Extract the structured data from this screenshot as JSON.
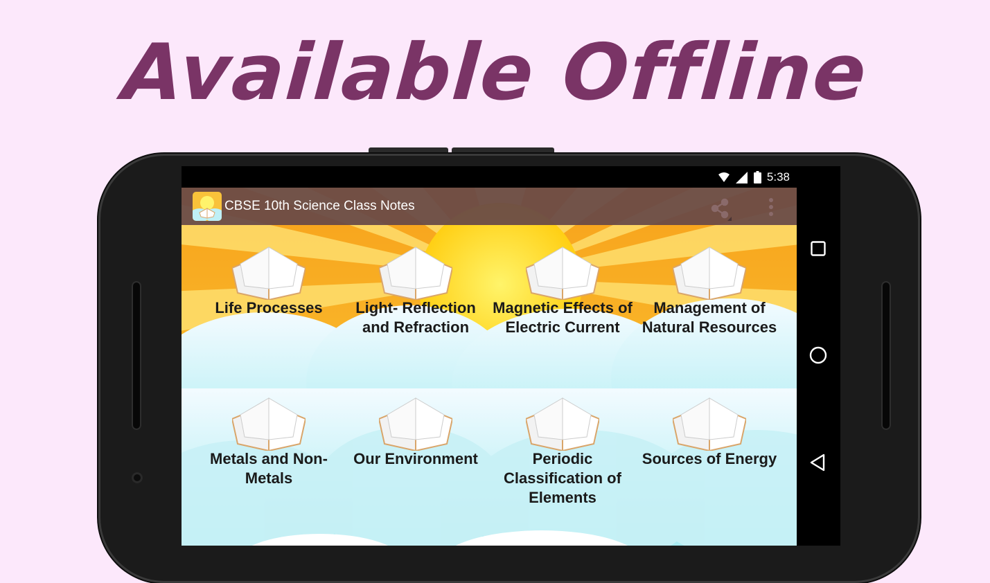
{
  "headline": "Available Offline",
  "status_bar": {
    "time": "5:38",
    "icons": [
      "wifi-icon",
      "signal-icon",
      "battery-icon"
    ]
  },
  "app_bar": {
    "title": "CBSE 10th Science Class Notes",
    "actions": [
      "share-icon",
      "more-vert-icon"
    ]
  },
  "chapters": [
    {
      "label": "Life Processes"
    },
    {
      "label": "Light- Reflection and Refraction"
    },
    {
      "label": "Magnetic Effects of Electric Current"
    },
    {
      "label": "Management of Natural Resources"
    },
    {
      "label": "Metals and Non-Metals"
    },
    {
      "label": "Our Environment"
    },
    {
      "label": "Periodic Classification of Elements"
    },
    {
      "label": "Sources of Energy"
    }
  ],
  "nav_bar": [
    "recents-icon",
    "home-icon",
    "back-icon"
  ],
  "colors": {
    "headline": "#7a3466",
    "background": "#fce8fb",
    "app_bar": "#664848",
    "sun": "#ffd21a",
    "sky": "#a8ecf2"
  }
}
